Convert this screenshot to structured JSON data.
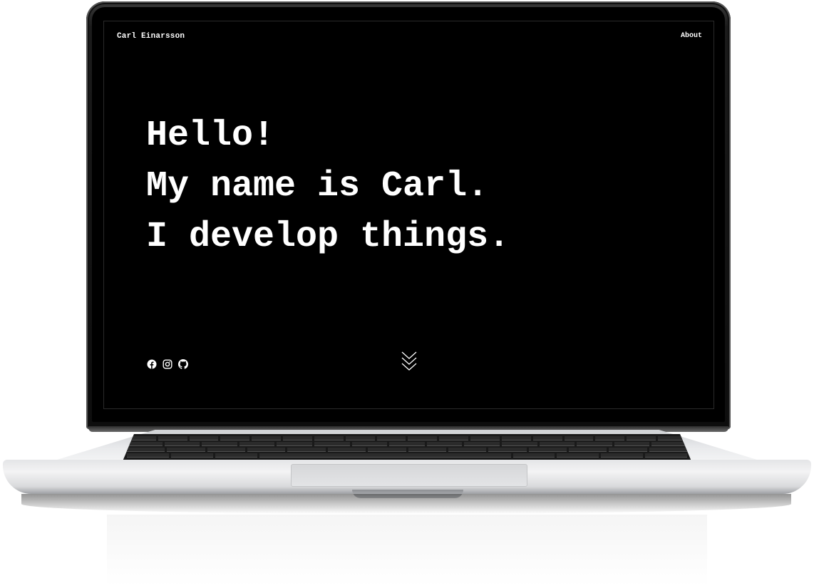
{
  "site": {
    "title": "Carl Einarsson",
    "nav": {
      "about_label": "About"
    }
  },
  "hero": {
    "lines": [
      "Hello!",
      "My name is Carl.",
      "I develop things."
    ]
  },
  "social": {
    "icons": [
      "facebook-icon",
      "instagram-icon",
      "github-icon"
    ]
  },
  "scroll": {
    "icon": "chevrons-down-icon"
  },
  "colors": {
    "screen_background": "#000000",
    "text": "#ffffff"
  }
}
